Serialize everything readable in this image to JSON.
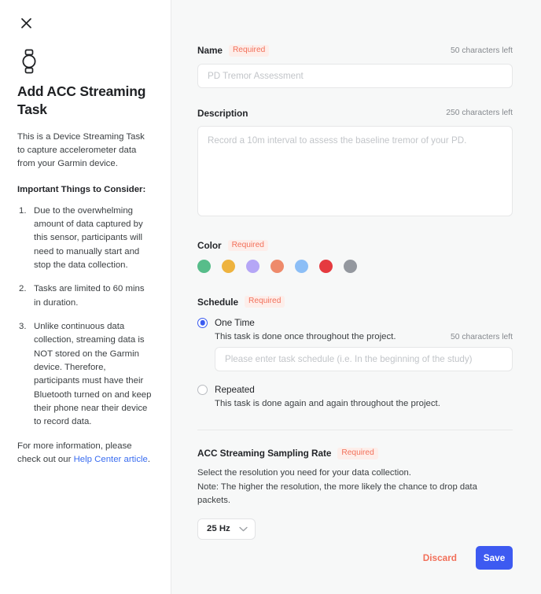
{
  "sidebar": {
    "close_icon": "close-icon",
    "device_icon": "watch-icon",
    "title": "Add ACC Streaming Task",
    "intro": "This is a Device Streaming Task to capture accelerometer data from your Garmin device.",
    "considerations_heading": "Important Things to Consider:",
    "considerations": [
      "Due to the overwhelming amount of data captured by this sensor, participants will need to manually start and stop the data collection.",
      "Tasks are limited to 60 mins in duration.",
      "Unlike continuous data collection, streaming data is NOT stored on the Garmin device. Therefore, participants must have their Bluetooth turned on and keep their phone near their device to record data."
    ],
    "footer_note_prefix": "For more information, please check out our ",
    "footer_link": "Help Center article",
    "footer_note_suffix": ".",
    "link_color": "#3a6df0"
  },
  "form": {
    "name": {
      "label": "Name",
      "required_badge": "Required",
      "char_count": "50 characters left",
      "placeholder": "PD Tremor Assessment",
      "value": ""
    },
    "description": {
      "label": "Description",
      "char_count": "250 characters left",
      "placeholder": "Record a 10m interval to assess the baseline tremor of your PD.",
      "value": ""
    },
    "color": {
      "label": "Color",
      "required_badge": "Required",
      "swatches": [
        {
          "name": "green",
          "hex": "#57bd8a"
        },
        {
          "name": "amber",
          "hex": "#eeb33f"
        },
        {
          "name": "purple",
          "hex": "#b5a6f6"
        },
        {
          "name": "salmon",
          "hex": "#ee8a6b"
        },
        {
          "name": "light-blue",
          "hex": "#8cbef6"
        },
        {
          "name": "red",
          "hex": "#e53a3f"
        },
        {
          "name": "gray",
          "hex": "#94989f"
        }
      ]
    },
    "schedule": {
      "label": "Schedule",
      "required_badge": "Required",
      "options": [
        {
          "id": "one-time",
          "label": "One Time",
          "description": "This task is done once throughout the project.",
          "selected": true,
          "char_count": "50 characters left",
          "input_placeholder": "Please enter task schedule (i.e. In the beginning of the study)",
          "input_value": ""
        },
        {
          "id": "repeated",
          "label": "Repeated",
          "description": "This task is done again and again throughout the project.",
          "selected": false
        }
      ]
    },
    "sampling_rate": {
      "label": "ACC Streaming Sampling Rate",
      "required_badge": "Required",
      "helper_line_1": "Select the resolution you need for your data collection.",
      "helper_line_2": "Note: The higher the resolution, the more likely the chance to drop data packets.",
      "selected_value": "25 Hz",
      "chevron_icon": "chevron-down-icon"
    }
  },
  "footer": {
    "discard_label": "Discard",
    "save_label": "Save",
    "discard_color": "#f2705a",
    "save_bg": "#3d5af1"
  }
}
